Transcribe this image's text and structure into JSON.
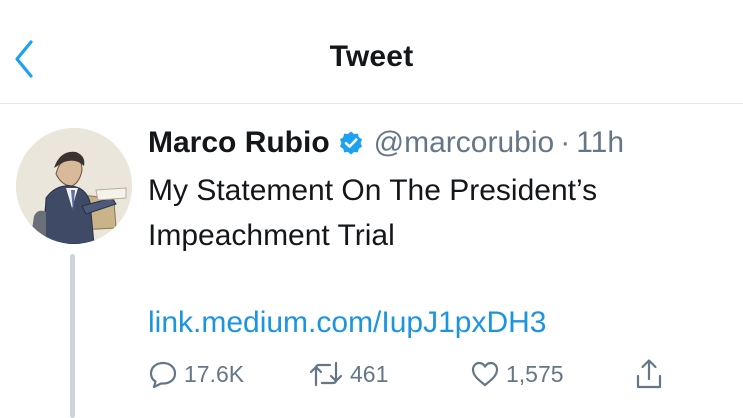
{
  "header": {
    "title": "Tweet",
    "back_icon": "chevron-left-icon",
    "accent_color": "#1da1f2"
  },
  "tweet": {
    "author_name": "Marco Rubio",
    "verified": true,
    "handle": "@marcorubio",
    "separator": "·",
    "time": "11h",
    "text_line1": "My Statement On The President’s",
    "text_line2": "Impeachment Trial",
    "link": "link.medium.com/IupJ1pxDH3",
    "link_color": "#1b95e0"
  },
  "actions": {
    "reply_count": "17.6K",
    "retweet_count": "461",
    "like_count": "1,575",
    "reply_icon": "reply-icon",
    "retweet_icon": "retweet-icon",
    "like_icon": "heart-icon",
    "share_icon": "share-icon"
  }
}
